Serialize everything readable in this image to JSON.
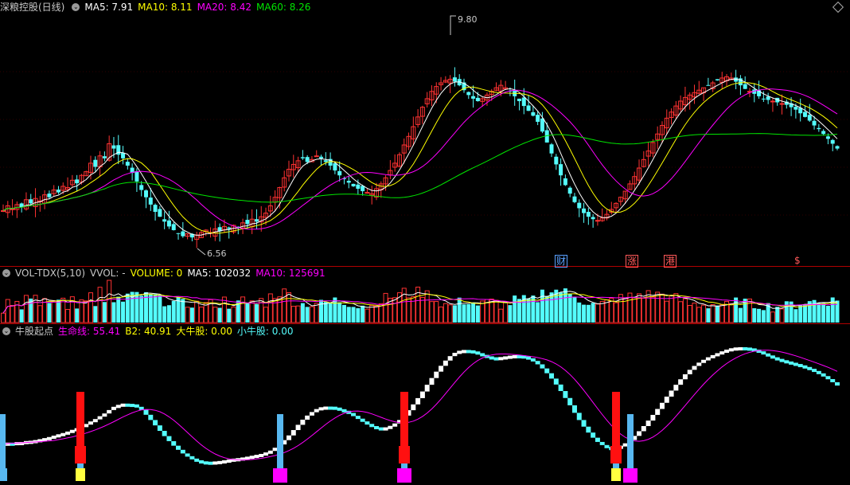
{
  "colors": {
    "up": "#ff3232",
    "down": "#54fcfc",
    "ma5": "#ffffff",
    "ma10": "#ffff00",
    "ma20": "#ff00ff",
    "ma60": "#00e600",
    "sep": "#b00000",
    "lifeline": "#ff00ff"
  },
  "header1": {
    "title": "深粮控股(日线)",
    "ma5": "MA5: 7.91",
    "ma10": "MA10: 8.11",
    "ma20": "MA20: 8.42",
    "ma60": "MA60: 8.26"
  },
  "header2": {
    "title": "VOL-TDX(5,10)",
    "vvol": "VVOL: -",
    "volume": "VOLUME: 0",
    "ma5": "MA5: 102032",
    "ma10": "MA10: 125691"
  },
  "header3": {
    "title": "牛股起点",
    "life": "生命线: 55.41",
    "b2": "B2: 40.91",
    "bigbull": "大牛股: 0.00",
    "smallbull": "小牛股: 0.00"
  },
  "annotations": {
    "high": "9.80",
    "low": "6.56"
  },
  "events": [
    {
      "text": "财",
      "color": "#5aa0ff"
    },
    {
      "text": "涨",
      "color": "#ff5a5a"
    },
    {
      "text": "港",
      "color": "#ff5a5a"
    },
    {
      "text": "$",
      "color": "#ff5a5a"
    }
  ],
  "chart_data": [
    {
      "type": "candlestick",
      "title": "深粮控股(日线)",
      "ylim": [
        6.3,
        10.2
      ],
      "highest": 9.8,
      "lowest": 6.56,
      "ma_last": {
        "MA5": 7.91,
        "MA10": 8.11,
        "MA20": 8.42,
        "MA60": 8.26
      },
      "series": [
        {
          "name": "close",
          "values": [
            7.0,
            7.08,
            7.03,
            7.1,
            7.06,
            7.18,
            7.12,
            7.2,
            7.16,
            7.26,
            7.22,
            7.34,
            7.3,
            7.4,
            7.38,
            7.5,
            7.45,
            7.58,
            7.64,
            7.78,
            7.72,
            7.9,
            7.86,
            8.1,
            8.02,
            7.92,
            7.86,
            7.74,
            7.62,
            7.48,
            7.34,
            7.22,
            7.1,
            6.98,
            6.9,
            6.82,
            6.74,
            6.68,
            6.62,
            6.58,
            6.62,
            6.56,
            6.6,
            6.64,
            6.68,
            6.64,
            6.7,
            6.66,
            6.74,
            6.7,
            6.76,
            6.72,
            6.8,
            6.78,
            6.86,
            6.82,
            6.9,
            6.96,
            7.08,
            7.22,
            7.38,
            7.54,
            7.68,
            7.76,
            7.82,
            7.86,
            7.8,
            7.84,
            7.9,
            7.86,
            7.8,
            7.74,
            7.66,
            7.58,
            7.52,
            7.46,
            7.4,
            7.36,
            7.32,
            7.3,
            7.28,
            7.36,
            7.44,
            7.54,
            7.66,
            7.78,
            7.92,
            8.08,
            8.22,
            8.38,
            8.54,
            8.7,
            8.84,
            8.96,
            9.04,
            9.1,
            9.14,
            9.16,
            9.12,
            9.06,
            8.98,
            8.9,
            8.84,
            8.8,
            8.84,
            8.9,
            8.96,
            9.02,
            9.06,
            9.02,
            8.96,
            8.88,
            8.8,
            8.72,
            8.64,
            8.56,
            8.46,
            8.3,
            8.12,
            7.94,
            7.76,
            7.58,
            7.42,
            7.28,
            7.14,
            7.04,
            6.96,
            6.9,
            6.86,
            6.84,
            6.88,
            6.94,
            7.02,
            7.12,
            7.22,
            7.32,
            7.44,
            7.56,
            7.7,
            7.84,
            7.98,
            8.12,
            8.26,
            8.4,
            8.52,
            8.62,
            8.72,
            8.8,
            8.86,
            8.9,
            8.94,
            8.98,
            9.02,
            9.06,
            9.1,
            9.14,
            9.18,
            9.2,
            9.18,
            9.12,
            9.06,
            9.0,
            8.96,
            8.92,
            8.88,
            8.84,
            8.82,
            8.8,
            8.78,
            8.76,
            8.74,
            8.7,
            8.66,
            8.6,
            8.54,
            8.48,
            8.4,
            8.34,
            8.26,
            8.18,
            8.1,
            8.02
          ]
        }
      ]
    },
    {
      "type": "bar",
      "title": "VOL-TDX(5,10)",
      "ma_last": {
        "MA5": 102032,
        "MA10": 125691
      }
    },
    {
      "type": "bar",
      "title": "牛股起点",
      "last": {
        "生命线": 55.41,
        "B2": 40.91,
        "大牛股": 0.0,
        "小牛股": 0.0
      }
    }
  ]
}
